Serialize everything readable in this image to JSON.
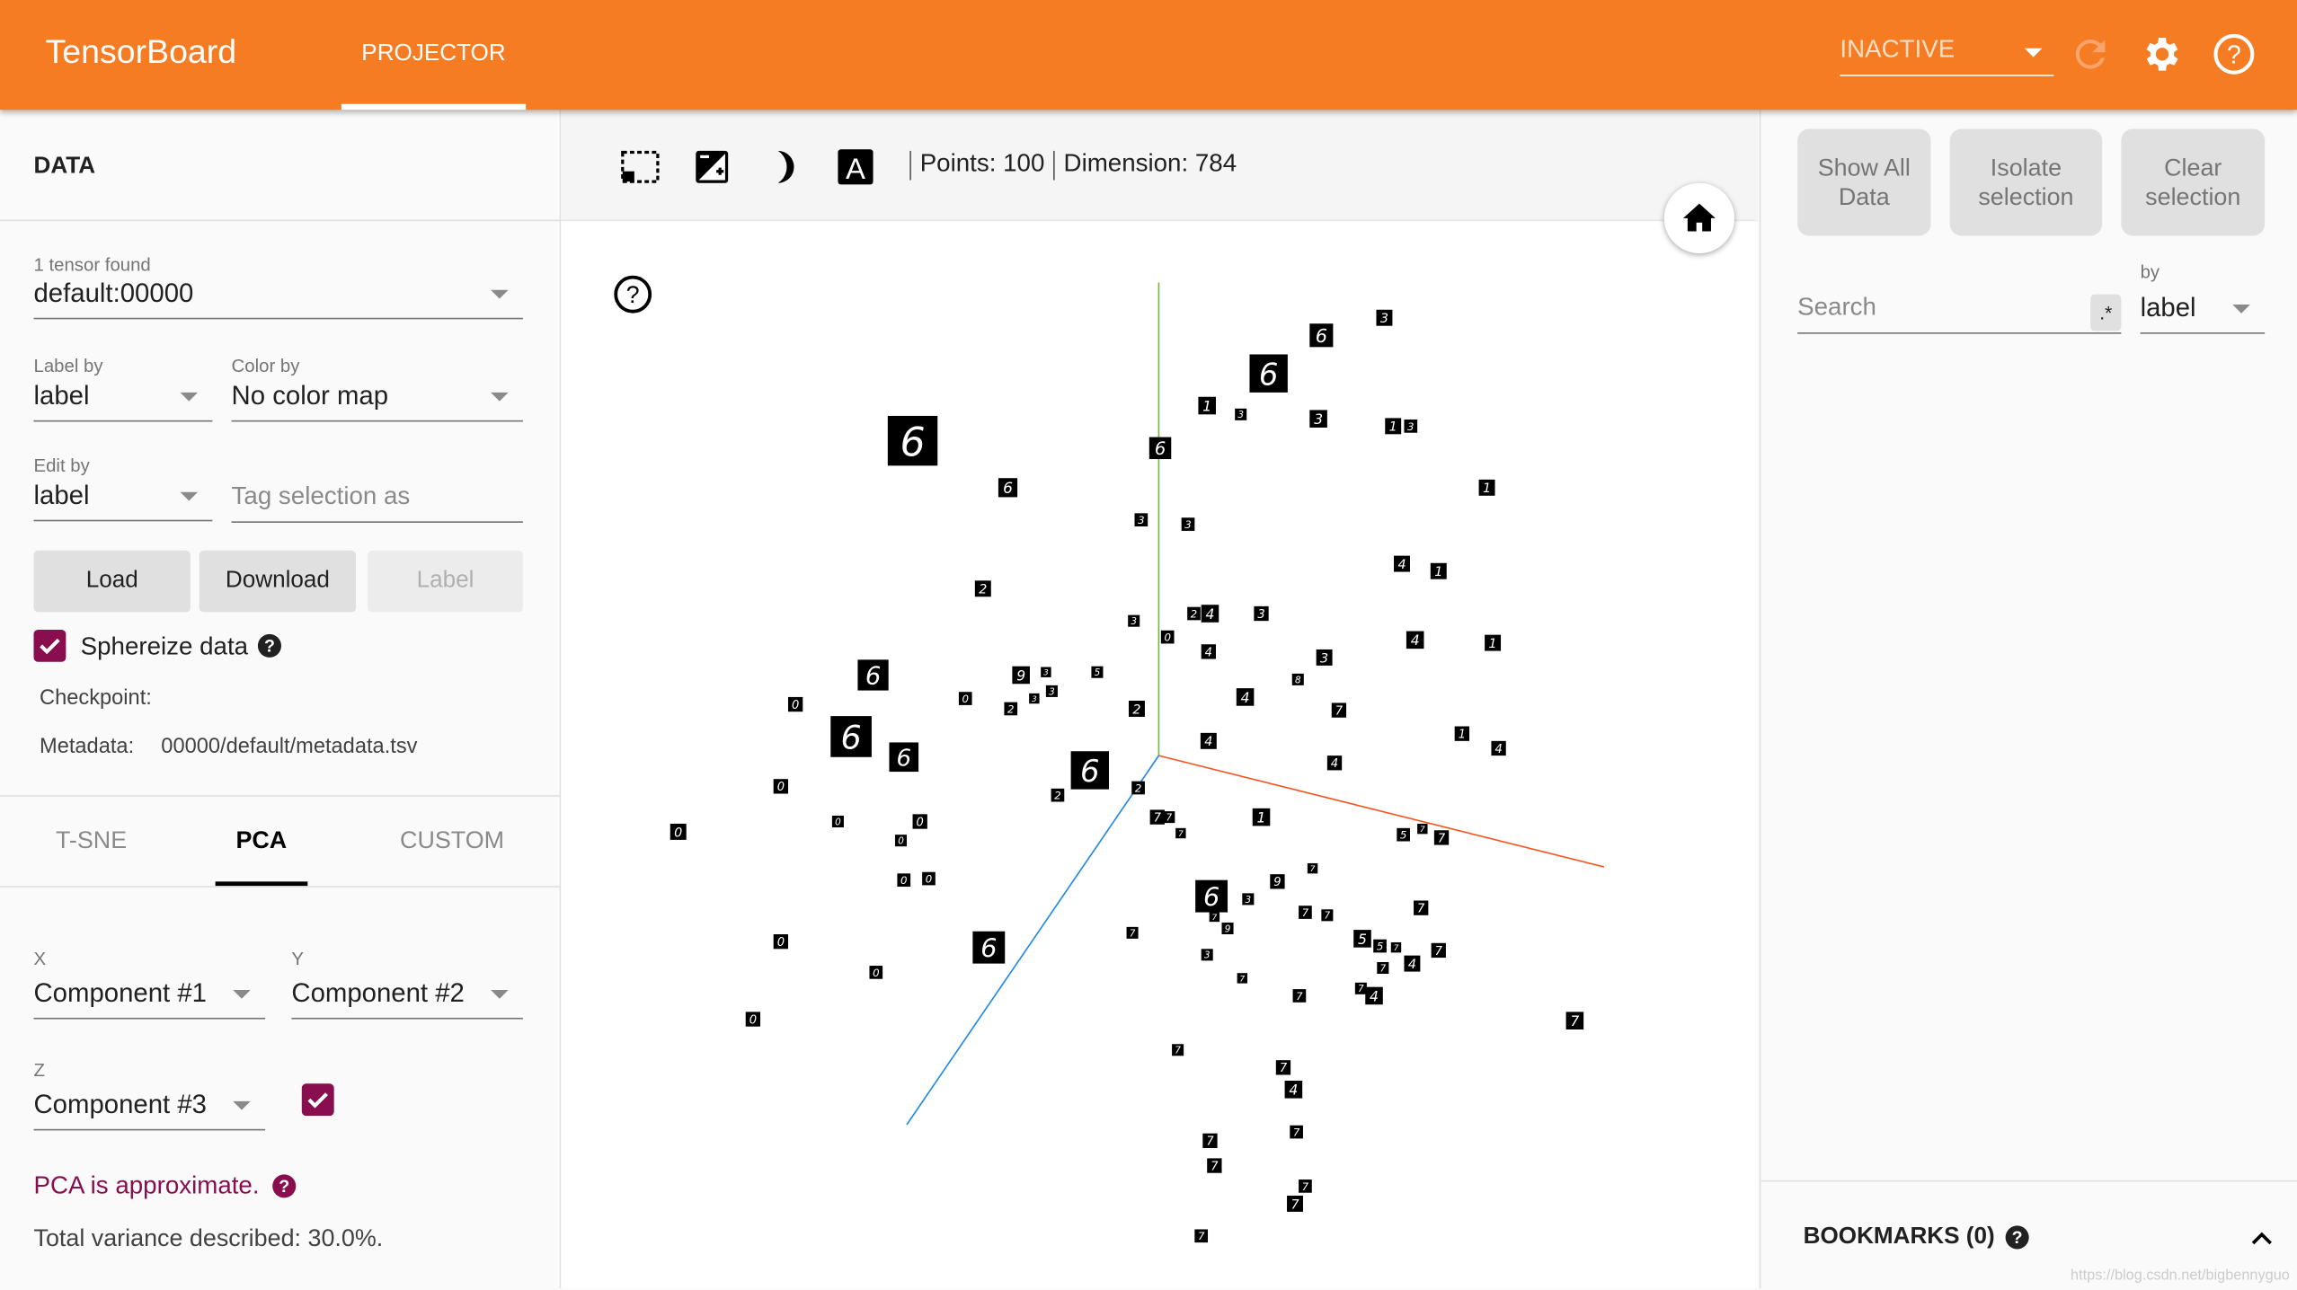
{
  "header": {
    "brand": "TensorBoard",
    "tab": "PROJECTOR",
    "run_select": "INACTIVE",
    "icons": [
      "refresh-icon",
      "settings-gear-icon",
      "help-circle-icon"
    ],
    "accent": "#f57c22"
  },
  "data_panel": {
    "title": "DATA",
    "tensor_label": "1 tensor found",
    "tensor_value": "default:00000",
    "label_by_label": "Label by",
    "label_by_value": "label",
    "color_by_label": "Color by",
    "color_by_value": "No color map",
    "edit_by_label": "Edit by",
    "edit_by_value": "label",
    "tag_placeholder": "Tag selection as",
    "buttons": {
      "load": "Load",
      "download": "Download",
      "label": "Label"
    },
    "sphereize_label": "Sphereize data",
    "sphereize_checked": true,
    "checkpoint_label": "Checkpoint:",
    "metadata_label": "Metadata:",
    "metadata_value": "00000/default/metadata.tsv",
    "checkbox_color": "#880e4f"
  },
  "projection": {
    "tabs": [
      "T-SNE",
      "PCA",
      "CUSTOM"
    ],
    "active_tab": "PCA",
    "x_label": "X",
    "x_value": "Component #1",
    "y_label": "Y",
    "y_value": "Component #2",
    "z_label": "Z",
    "z_value": "Component #3",
    "z_enabled": true,
    "approx_note": "PCA is approximate.",
    "variance": "Total variance described: 30.0%."
  },
  "toolbar": {
    "points": "Points: 100",
    "dimension": "Dimension: 784",
    "icons": [
      "select-rectangle-icon",
      "night-mode-contrast-icon",
      "moon-icon",
      "label-a-icon"
    ],
    "home_icon": "home-icon",
    "help_icon": "help-circle-icon"
  },
  "axes_colors": {
    "x": "#f4511e",
    "y": "#7cb342",
    "z": "#1e88e5"
  },
  "inspector": {
    "show_all": "Show All Data",
    "isolate": "Isolate selection",
    "clear": "Clear selection",
    "search_placeholder": "Search",
    "regex_label": ".*",
    "by_label": "by",
    "by_value": "label"
  },
  "bookmarks": {
    "title": "BOOKMARKS (0)"
  },
  "watermark": "https://blog.csdn.net/bigbennyguo"
}
